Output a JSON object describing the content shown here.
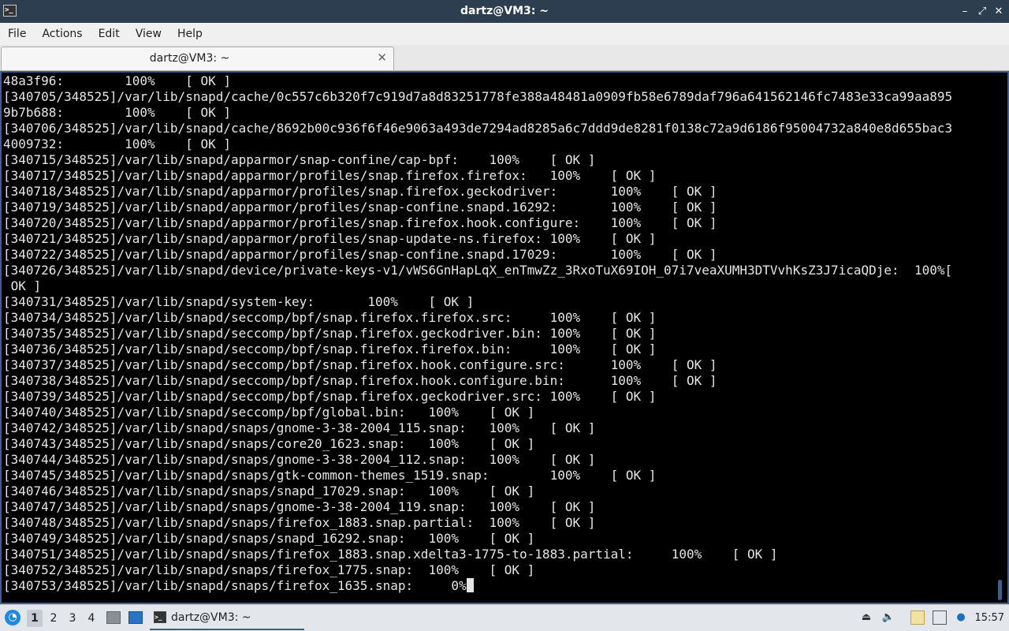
{
  "window": {
    "title": "dartz@VM3: ~",
    "app_icon": "terminal-icon",
    "controls": {
      "minimize": "–",
      "maximize": "⤢",
      "close": "✕"
    }
  },
  "menu": [
    "File",
    "Actions",
    "Edit",
    "View",
    "Help"
  ],
  "tab": {
    "label": "dartz@VM3: ~",
    "close": "✕"
  },
  "terminal": {
    "lines": [
      "48a3f96:        100%    [ OK ]",
      "[340705/348525]/var/lib/snapd/cache/0c557c6b320f7c919d7a8d83251778fe388a48481a0909fb58e6789daf796a641562146fc7483e33ca99aa895",
      "9b7b688:        100%    [ OK ]",
      "[340706/348525]/var/lib/snapd/cache/8692b00c936f6f46e9063a493de7294ad8285a6c7ddd9de8281f0138c72a9d6186f95004732a840e8d655bac3",
      "4009732:        100%    [ OK ]",
      "[340715/348525]/var/lib/snapd/apparmor/snap-confine/cap-bpf:    100%    [ OK ]",
      "[340717/348525]/var/lib/snapd/apparmor/profiles/snap.firefox.firefox:   100%    [ OK ]",
      "[340718/348525]/var/lib/snapd/apparmor/profiles/snap.firefox.geckodriver:       100%    [ OK ]",
      "[340719/348525]/var/lib/snapd/apparmor/profiles/snap-confine.snapd.16292:       100%    [ OK ]",
      "[340720/348525]/var/lib/snapd/apparmor/profiles/snap.firefox.hook.configure:    100%    [ OK ]",
      "[340721/348525]/var/lib/snapd/apparmor/profiles/snap-update-ns.firefox: 100%    [ OK ]",
      "[340722/348525]/var/lib/snapd/apparmor/profiles/snap-confine.snapd.17029:       100%    [ OK ]",
      "[340726/348525]/var/lib/snapd/device/private-keys-v1/vWS6GnHapLqX_enTmwZz_3RxoTuX69IOH_07i7veaXUMH3DTVvhKsZ3J7icaQDje:  100%[",
      " OK ]",
      "[340731/348525]/var/lib/snapd/system-key:       100%    [ OK ]",
      "[340734/348525]/var/lib/snapd/seccomp/bpf/snap.firefox.firefox.src:     100%    [ OK ]",
      "[340735/348525]/var/lib/snapd/seccomp/bpf/snap.firefox.geckodriver.bin: 100%    [ OK ]",
      "[340736/348525]/var/lib/snapd/seccomp/bpf/snap.firefox.firefox.bin:     100%    [ OK ]",
      "[340737/348525]/var/lib/snapd/seccomp/bpf/snap.firefox.hook.configure.src:      100%    [ OK ]",
      "[340738/348525]/var/lib/snapd/seccomp/bpf/snap.firefox.hook.configure.bin:      100%    [ OK ]",
      "[340739/348525]/var/lib/snapd/seccomp/bpf/snap.firefox.geckodriver.src: 100%    [ OK ]",
      "[340740/348525]/var/lib/snapd/seccomp/bpf/global.bin:   100%    [ OK ]",
      "[340742/348525]/var/lib/snapd/snaps/gnome-3-38-2004_115.snap:   100%    [ OK ]",
      "[340743/348525]/var/lib/snapd/snaps/core20_1623.snap:   100%    [ OK ]",
      "[340744/348525]/var/lib/snapd/snaps/gnome-3-38-2004_112.snap:   100%    [ OK ]",
      "[340745/348525]/var/lib/snapd/snaps/gtk-common-themes_1519.snap:        100%    [ OK ]",
      "[340746/348525]/var/lib/snapd/snaps/snapd_17029.snap:   100%    [ OK ]",
      "[340747/348525]/var/lib/snapd/snaps/gnome-3-38-2004_119.snap:   100%    [ OK ]",
      "[340748/348525]/var/lib/snapd/snaps/firefox_1883.snap.partial:  100%    [ OK ]",
      "[340749/348525]/var/lib/snapd/snaps/snapd_16292.snap:   100%    [ OK ]",
      "[340751/348525]/var/lib/snapd/snaps/firefox_1883.snap.xdelta3-1775-to-1883.partial:     100%    [ OK ]",
      "[340752/348525]/var/lib/snapd/snaps/firefox_1775.snap:  100%    [ OK ]",
      "[340753/348525]/var/lib/snapd/snaps/firefox_1635.snap:     0%"
    ]
  },
  "taskbar": {
    "start_icon": "start-menu-icon",
    "desktops": [
      "1",
      "2",
      "3",
      "4"
    ],
    "active_desktop": "1",
    "task_label": "dartz@VM3: ~",
    "tray_icons": [
      "eject-icon",
      "volume-icon",
      "clipboard-icon",
      "network-icon",
      "updates-icon"
    ],
    "clock": "15:57"
  },
  "colors": {
    "titlebar": "#2c3e50",
    "accent": "#3d5f8a",
    "terminal_bg": "#000000",
    "terminal_fg": "#e5e5e5"
  }
}
